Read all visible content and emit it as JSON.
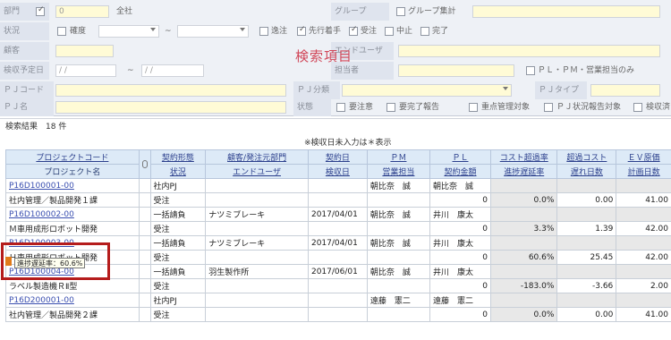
{
  "search": {
    "title": "検索項目",
    "dept": {
      "label": "部門",
      "value": "0",
      "name": "全社"
    },
    "group": {
      "label": "グループ",
      "total_label": "グループ集計"
    },
    "status": {
      "label": "状況",
      "confirm": "確度",
      "tilde": "~",
      "options": [
        "逸注",
        "先行着手",
        "受注",
        "中止",
        "完了"
      ],
      "checked": [
        false,
        true,
        true,
        false,
        false
      ]
    },
    "customer": {
      "label": "顧客",
      "end_user_label": "エンドユーザ"
    },
    "inspect_date": {
      "label": "検収予定日",
      "from": "/  /",
      "tilde": "~",
      "to": "/  /",
      "person_label": "担当者",
      "pl_only": "ＰＬ・ＰＭ・営業担当のみ"
    },
    "pj_code": {
      "label": "ＰＪコード",
      "class_label": "ＰＪ分類",
      "type_label": "ＰＪタイプ"
    },
    "pj_name": {
      "label": "ＰＪ名",
      "state_label": "状態",
      "options": [
        "要注意",
        "要完了報告",
        "重点管理対象",
        "ＰＪ状況報告対象",
        "検収済"
      ]
    }
  },
  "results": {
    "count_text": "検索結果　18 件",
    "note": "※検収日未入力は＊表示",
    "headers_top": [
      "プロジェクトコード",
      "",
      "契約形態",
      "顧客/発注元部門",
      "契約日",
      "ＰＭ",
      "ＰＬ",
      "コスト超過率",
      "超過コスト",
      "ＥＶ原価"
    ],
    "headers_bottom": [
      "プロジェクト名",
      "",
      "状況",
      "エンドユーザ",
      "検収日",
      "営業担当",
      "契約金額",
      "進捗遅延率",
      "遅れ日数",
      "計画日数"
    ],
    "rows": [
      {
        "top": [
          "P16D100001-00",
          "",
          "社内PJ",
          "",
          "",
          "朝比奈　誠",
          "朝比奈　誠",
          "",
          "",
          ""
        ],
        "bottom": [
          "社内管理／製品開発１課",
          "",
          "受注",
          "",
          "",
          "",
          "0",
          "0.0%",
          "0.00",
          "41.00"
        ]
      },
      {
        "top": [
          "P16D100002-00",
          "",
          "一括請負",
          "ナツミブレーキ",
          "2017/04/01",
          "朝比奈　誠",
          "井川　康太",
          "",
          "",
          ""
        ],
        "bottom": [
          "Ｍ車用成形ロボット開発",
          "",
          "受注",
          "",
          "",
          "",
          "0",
          "3.3%",
          "1.39",
          "42.00"
        ]
      },
      {
        "top": [
          "P16D100003-00",
          "",
          "一括請負",
          "ナツミブレーキ",
          "2017/04/01",
          "朝比奈　誠",
          "井川　康太",
          "",
          "",
          ""
        ],
        "bottom": [
          "Ｈ車用成形ロボット開発",
          "",
          "受注",
          "",
          "",
          "",
          "0",
          "60.6%",
          "25.45",
          "42.00"
        ]
      },
      {
        "top": [
          "P16D100004-00",
          "",
          "一括請負",
          "羽生製作所",
          "2017/06/01",
          "朝比奈　誠",
          "井川　康太",
          "",
          "",
          ""
        ],
        "bottom": [
          "ラベル製造機ＲⅡ型",
          "",
          "受注",
          "",
          "",
          "",
          "0",
          "-183.0%",
          "-3.66",
          "2.00"
        ]
      },
      {
        "top": [
          "P16D200001-00",
          "",
          "社内PJ",
          "",
          "",
          "遠藤　憲二",
          "遠藤　憲二",
          "",
          "",
          ""
        ],
        "bottom": [
          "社内管理／製品開発２課",
          "",
          "受注",
          "",
          "",
          "",
          "0",
          "0.0%",
          "0.00",
          "41.00"
        ]
      }
    ],
    "tooltip": "進捗遅延率：60.6%"
  }
}
